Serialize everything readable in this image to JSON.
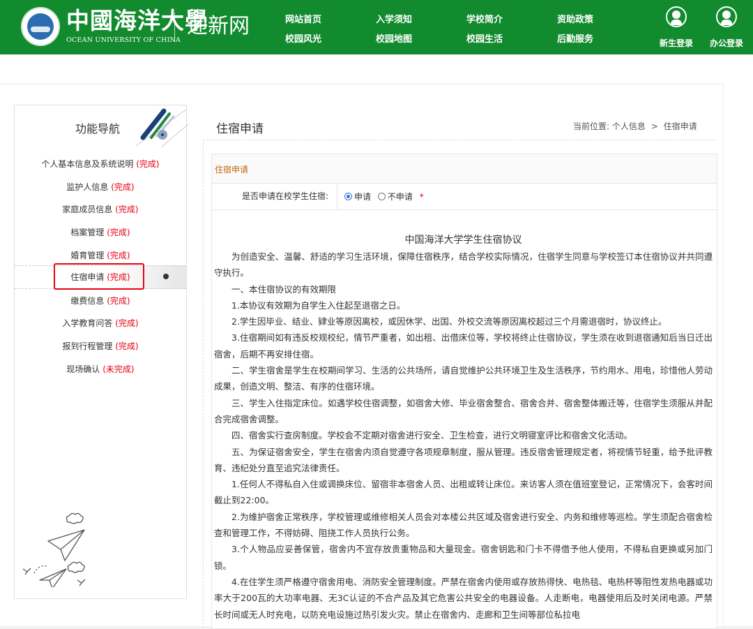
{
  "header": {
    "logo_badge_text": "1924 OCEAN UNIVERSITY OF CHINA",
    "logo_cn": "中國海洋大學",
    "logo_en": "OCEAN UNIVERSITY OF CHINA",
    "site_title": "迎新网",
    "nav_top": [
      "网站首页",
      "入学须知",
      "学校简介",
      "资助政策"
    ],
    "nav_bottom": [
      "校园风光",
      "校园地图",
      "校园生活",
      "后勤服务"
    ],
    "freshman_login": "新生登录",
    "office_login": "办公登录",
    "colors": {
      "header_bg": "#128a2e",
      "status_red": "#e60012",
      "section_orange": "#c06a0d"
    }
  },
  "sidebar": {
    "title": "功能导航",
    "items": [
      {
        "label": "个人基本信息及系统说明",
        "status": "(完成)"
      },
      {
        "label": "监护人信息",
        "status": "(完成)"
      },
      {
        "label": "家庭成员信息",
        "status": "(完成)"
      },
      {
        "label": "档案管理",
        "status": "(完成)"
      },
      {
        "label": "婚育管理",
        "status": "(完成)"
      },
      {
        "label": "住宿申请",
        "status": "(完成)"
      },
      {
        "label": "缴费信息",
        "status": "(完成)"
      },
      {
        "label": "入学教育问答",
        "status": "(完成)"
      },
      {
        "label": "报到行程管理",
        "status": "(完成)"
      },
      {
        "label": "现场确认",
        "status": "(未完成)"
      }
    ],
    "active_item": "住宿申请"
  },
  "main": {
    "title": "住宿申请",
    "breadcrumb": {
      "prefix": "当前位置:",
      "level1": "个人信息",
      "separator": ">",
      "level2": "住宿申请"
    },
    "section_title": "住宿申请",
    "question": {
      "label": "是否申请在校学生住宿:",
      "options": [
        "申请",
        "不申请"
      ],
      "selected": "申请",
      "required_mark": "*"
    },
    "agreement": {
      "title": "中国海洋大学学生住宿协议",
      "paragraphs": [
        "为创造安全、温馨、舒适的学习生活环境，保障住宿秩序，结合学校实际情况，住宿学生同意与学校签订本住宿协议并共同遵守执行。",
        "一、本住宿协议的有效期限",
        "1.本协议有效期为自学生入住起至退宿之日。",
        "2.学生因毕业、结业、肄业等原因离校，或因休学、出国、外校交流等原因离校超过三个月需退宿时，协议终止。",
        "3.住宿期间如有违反校规校纪，情节严重者，如出租、出借床位等，学校将终止住宿协议，学生须在收到退宿通知后当日迁出宿舍，后期不再安排住宿。",
        "二、学生宿舍是学生在校期间学习、生活的公共场所，请自觉维护公共环境卫生及生活秩序，节约用水、用电，珍惜他人劳动成果，创造文明、整洁、有序的住宿环境。",
        "三、学生入住指定床位。如遇学校住宿调整，如宿舍大修、毕业宿舍整合、宿舍合并、宿舍整体搬迁等，住宿学生须服从并配合完成宿舍调整。",
        "四、宿舍实行查房制度。学校会不定期对宿舍进行安全、卫生检查，进行文明寝室评比和宿舍文化活动。",
        "五、为保证宿舍安全，学生在宿舍内须自觉遵守各项规章制度，服从管理。违反宿舍管理规定者，将视情节轻重，给予批评教育、违纪处分直至追究法律责任。",
        "1.任何人不得私自入住或调换床位、留宿非本宿舍人员、出租或转让床位。来访客人须在值班室登记，正常情况下，会客时间截止到22:00。",
        "2.为维护宿舍正常秩序，学校管理或维修相关人员会对本楼公共区域及宿舍进行安全、内务和维修等巡检。学生须配合宿舍检查和管理工作，不得妨碍、阻挠工作人员执行公务。",
        "3.个人物品应妥善保管，宿舍内不宜存放贵重物品和大量现金。宿舍钥匙和门卡不得借予他人使用，不得私自更换或另加门锁。",
        "4.在住学生须严格遵守宿舍用电、消防安全管理制度。严禁在宿舍内使用或存放热得快、电热毯、电热杯等阻性发热电器或功率大于200瓦的大功率电器、无3C认证的不合产品及其它危害公共安全的电器设备。人走断电，电器使用后及时关闭电源。严禁长时间或无人时充电，以防充电设施过热引发火灾。禁止在宿舍内、走廊和卫生间等部位私拉电"
      ]
    }
  }
}
